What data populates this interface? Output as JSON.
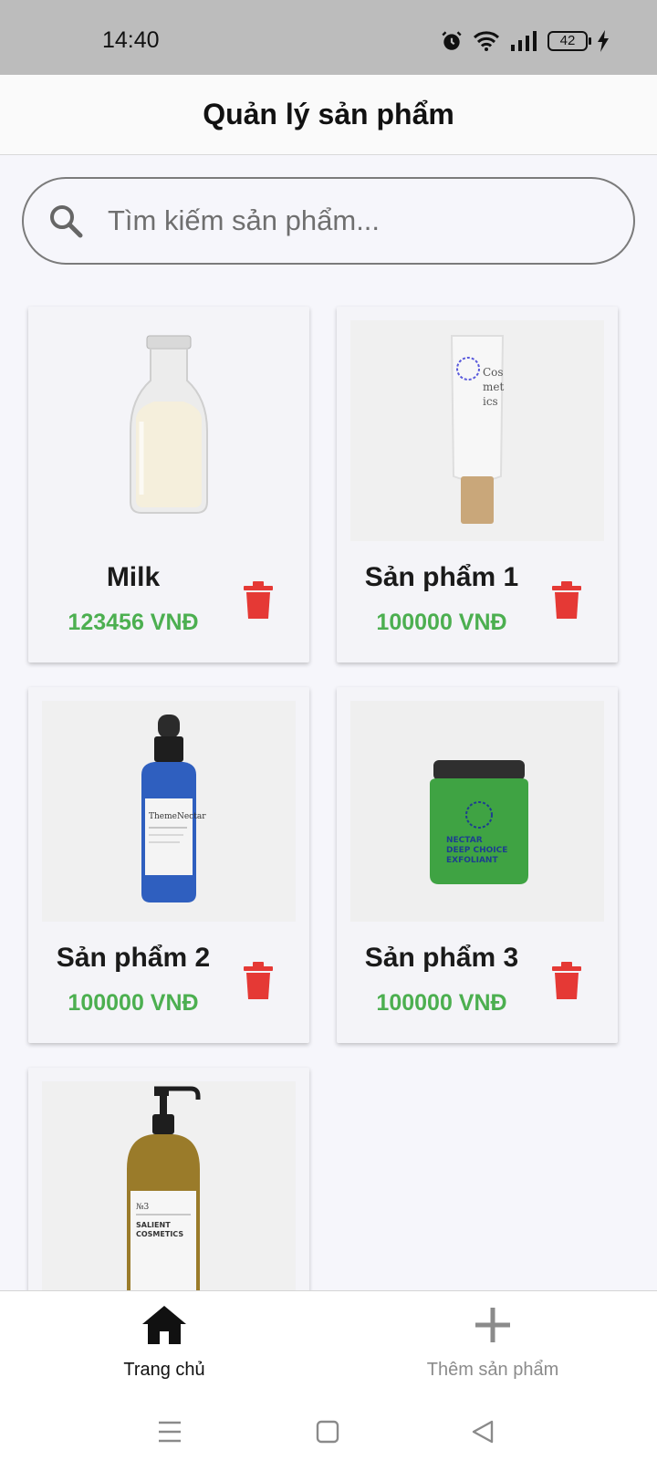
{
  "status_bar": {
    "time": "14:40",
    "battery": "42"
  },
  "header": {
    "title": "Quản lý sản phẩm"
  },
  "search": {
    "placeholder": "Tìm kiếm sản phẩm...",
    "value": ""
  },
  "products": [
    {
      "name": "Milk",
      "price": "123456 VNĐ"
    },
    {
      "name": "Sản phẩm 1",
      "price": "100000 VNĐ"
    },
    {
      "name": "Sản phẩm 2",
      "price": "100000 VNĐ"
    },
    {
      "name": "Sản phẩm 3",
      "price": "100000 VNĐ"
    },
    {
      "name": "",
      "price": ""
    }
  ],
  "product_images": {
    "tube": {
      "label_1": "Cos",
      "label_2": "met",
      "label_3": "ics"
    },
    "dropper": {
      "label": "ThemeNectar"
    },
    "jar": {
      "label_1": "NECTAR",
      "label_2": "DEEP CHOICE",
      "label_3": "EXFOLIANT"
    },
    "pump": {
      "label_1": "№3",
      "label_2": "SALIENT",
      "label_3": "COSMETICS"
    }
  },
  "bottom_nav": {
    "home_label": "Trang chủ",
    "add_label": "Thêm sản phẩm"
  },
  "colors": {
    "price": "#4caf50",
    "delete": "#e53935",
    "accent": "#111111"
  }
}
